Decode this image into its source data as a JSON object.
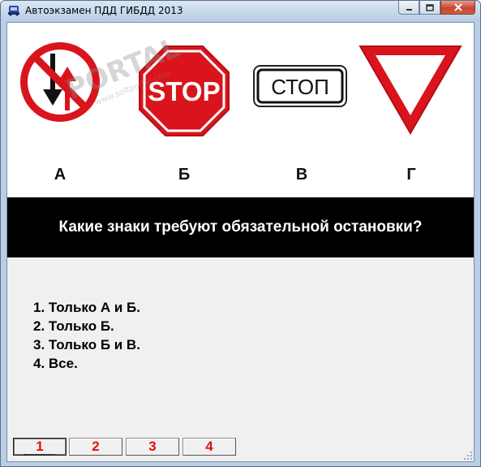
{
  "window": {
    "title": "Автоэкзамен ПДД ГИБДД 2013",
    "app_icon": "car-icon",
    "controls": {
      "minimize_icon": "minimize-icon",
      "maximize_icon": "maximize-icon",
      "close_icon": "close-icon"
    }
  },
  "watermark": {
    "text": "PORTAL",
    "url": "www.softportal.com",
    "tm": "TM"
  },
  "signs": [
    {
      "letter": "А",
      "icon": "priority-to-oncoming-traffic-sign-icon"
    },
    {
      "letter": "Б",
      "icon": "stop-octagon-sign-icon",
      "text": "STOP"
    },
    {
      "letter": "В",
      "icon": "stop-rectangle-sign-icon",
      "text": "СТОП"
    },
    {
      "letter": "Г",
      "icon": "yield-triangle-sign-icon"
    }
  ],
  "question": "Какие знаки требуют обязательной остановки?",
  "answers": [
    "1. Только А и Б.",
    "2. Только Б.",
    "3. Только Б и В.",
    "4. Все."
  ],
  "answer_buttons": [
    "1",
    "2",
    "3",
    "4"
  ],
  "colors": {
    "sign_red": "#d9141c",
    "button_text": "#e01010",
    "question_bg": "#000000"
  }
}
